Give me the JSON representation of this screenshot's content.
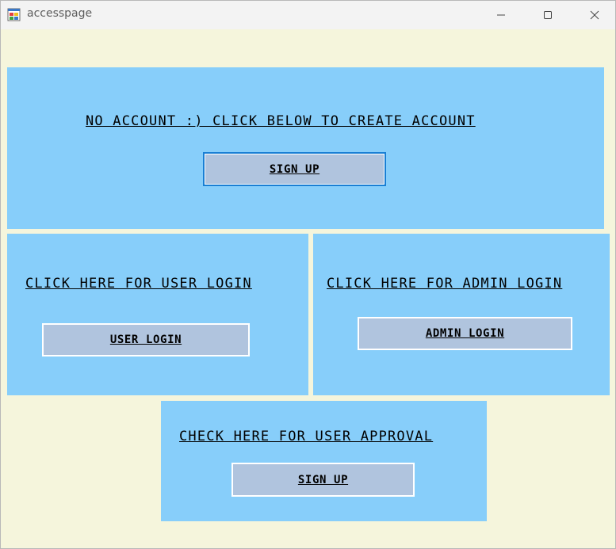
{
  "window": {
    "title": "accesspage",
    "icon": "app-window-icon",
    "controls": {
      "minimize": "minimize-icon",
      "maximize": "maximize-icon",
      "close": "close-icon"
    }
  },
  "signup_panel": {
    "label": "NO ACCOUNT :) CLICK BELOW TO CREATE ACCOUNT",
    "button": "SIGN UP"
  },
  "user_panel": {
    "label": "CLICK HERE FOR USER LOGIN",
    "button": "USER LOGIN"
  },
  "admin_panel": {
    "label": "CLICK HERE FOR ADMIN LOGIN",
    "button": "ADMIN LOGIN"
  },
  "approval_panel": {
    "label": "CHECK HERE FOR USER APPROVAL",
    "button": "SIGN UP"
  },
  "colors": {
    "form_background": "#f5f5dc",
    "panel_background": "#87cefa",
    "button_background": "#b0c4de",
    "focus_border": "#1a7fd4"
  }
}
